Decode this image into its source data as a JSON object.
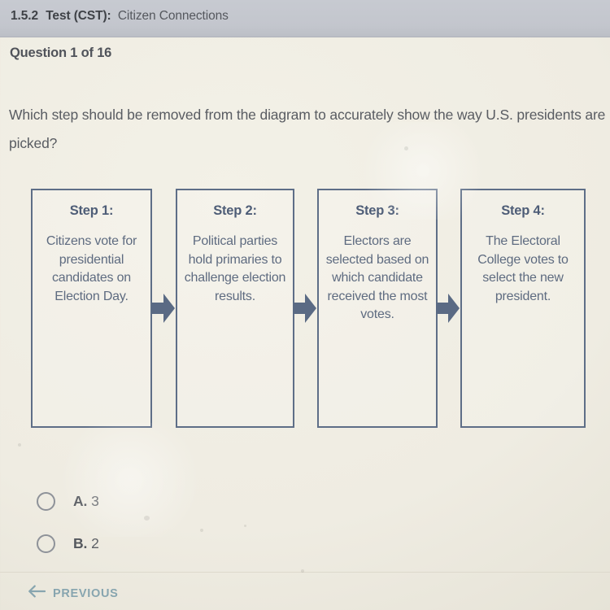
{
  "header": {
    "lesson_code": "1.5.2",
    "test_label": "Test (CST):",
    "subject": "Citizen Connections"
  },
  "question_counter": "Question 1 of 16",
  "question": {
    "stem": "Which step should be removed from the diagram to accurately show the way U.S. presidents are picked?"
  },
  "diagram": {
    "type": "flowchart",
    "orientation": "horizontal",
    "connector": "block-arrow-right",
    "steps": [
      {
        "title": "Step 1:",
        "body": "Citizens vote for presidential candidates on Election Day."
      },
      {
        "title": "Step 2:",
        "body": "Political parties hold primaries to challenge election results."
      },
      {
        "title": "Step 3:",
        "body": "Electors are selected based on which candidate received the most votes."
      },
      {
        "title": "Step 4:",
        "body": "The Electoral College votes to select the new president."
      }
    ]
  },
  "answers": {
    "selected": null,
    "options": [
      {
        "letter": "A.",
        "text": "3"
      },
      {
        "letter": "B.",
        "text": "2"
      }
    ]
  },
  "footer": {
    "previous_label": "PREVIOUS",
    "previous_icon": "arrow-left-icon"
  },
  "colors": {
    "page_background": "#efece2",
    "header_background": "#c3c6cd",
    "body_text": "#595c62",
    "diagram_border": "#5e6e87",
    "diagram_text": "#5e6b80",
    "diagram_title_text": "#4e5d77",
    "link_accent": "#87a5af",
    "radio_border": "#8e9299"
  }
}
